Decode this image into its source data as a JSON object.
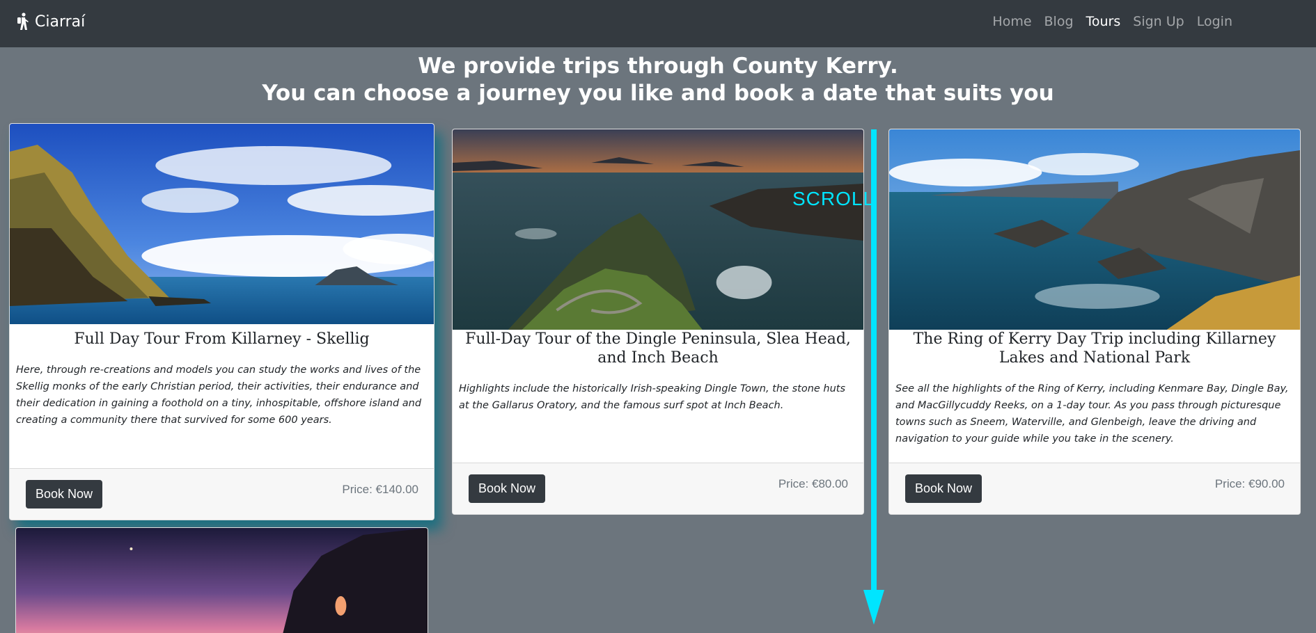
{
  "navbar": {
    "brand": "Ciarraí",
    "links": [
      {
        "label": "Home",
        "active": false
      },
      {
        "label": "Blog",
        "active": false
      },
      {
        "label": "Tours",
        "active": true
      },
      {
        "label": "Sign Up",
        "active": false
      },
      {
        "label": "Login",
        "active": false
      }
    ]
  },
  "headline": {
    "line1": "We provide trips through County Kerry.",
    "line2": "You can choose a journey you like and book a date that suits you"
  },
  "tours": [
    {
      "title": "Full Day Tour From Killarney - Skellig",
      "description": "Here, through re-creations and models you can study the works and lives of the Skellig monks of the early Christian period, their activities, their endurance and their dedication in gaining a foothold on a tiny, inhospitable, offshore island and creating a community there that survived for some 600 years.",
      "button": "Book Now",
      "price": "Price: €140.00",
      "image": "skellig-islands-photo"
    },
    {
      "title": "Full-Day Tour of the Dingle Peninsula, Slea Head, and Inch Beach",
      "description": "Highlights include the historically Irish-speaking Dingle Town, the stone huts at the Gallarus Oratory, and the famous surf spot at Inch Beach.",
      "button": "Book Now",
      "price": "Price: €80.00",
      "image": "dingle-peninsula-sunset-photo"
    },
    {
      "title": "The Ring of Kerry Day Trip including Killarney Lakes and National Park",
      "description": "See all the highlights of the Ring of Kerry, including Kenmare Bay, Dingle Bay, and MacGillycuddy Reeks, on a 1-day tour. As you pass through picturesque towns such as Sneem, Waterville, and Glenbeigh, leave the driving and navigation to your guide while you take in the scenery.",
      "button": "Book Now",
      "price": "Price: €90.00",
      "image": "kerry-cliffs-photo"
    },
    {
      "image": "sea-arch-twilight-photo"
    }
  ],
  "overlay": {
    "scroll_label": "SCROLL",
    "color": "#00e5ff"
  }
}
